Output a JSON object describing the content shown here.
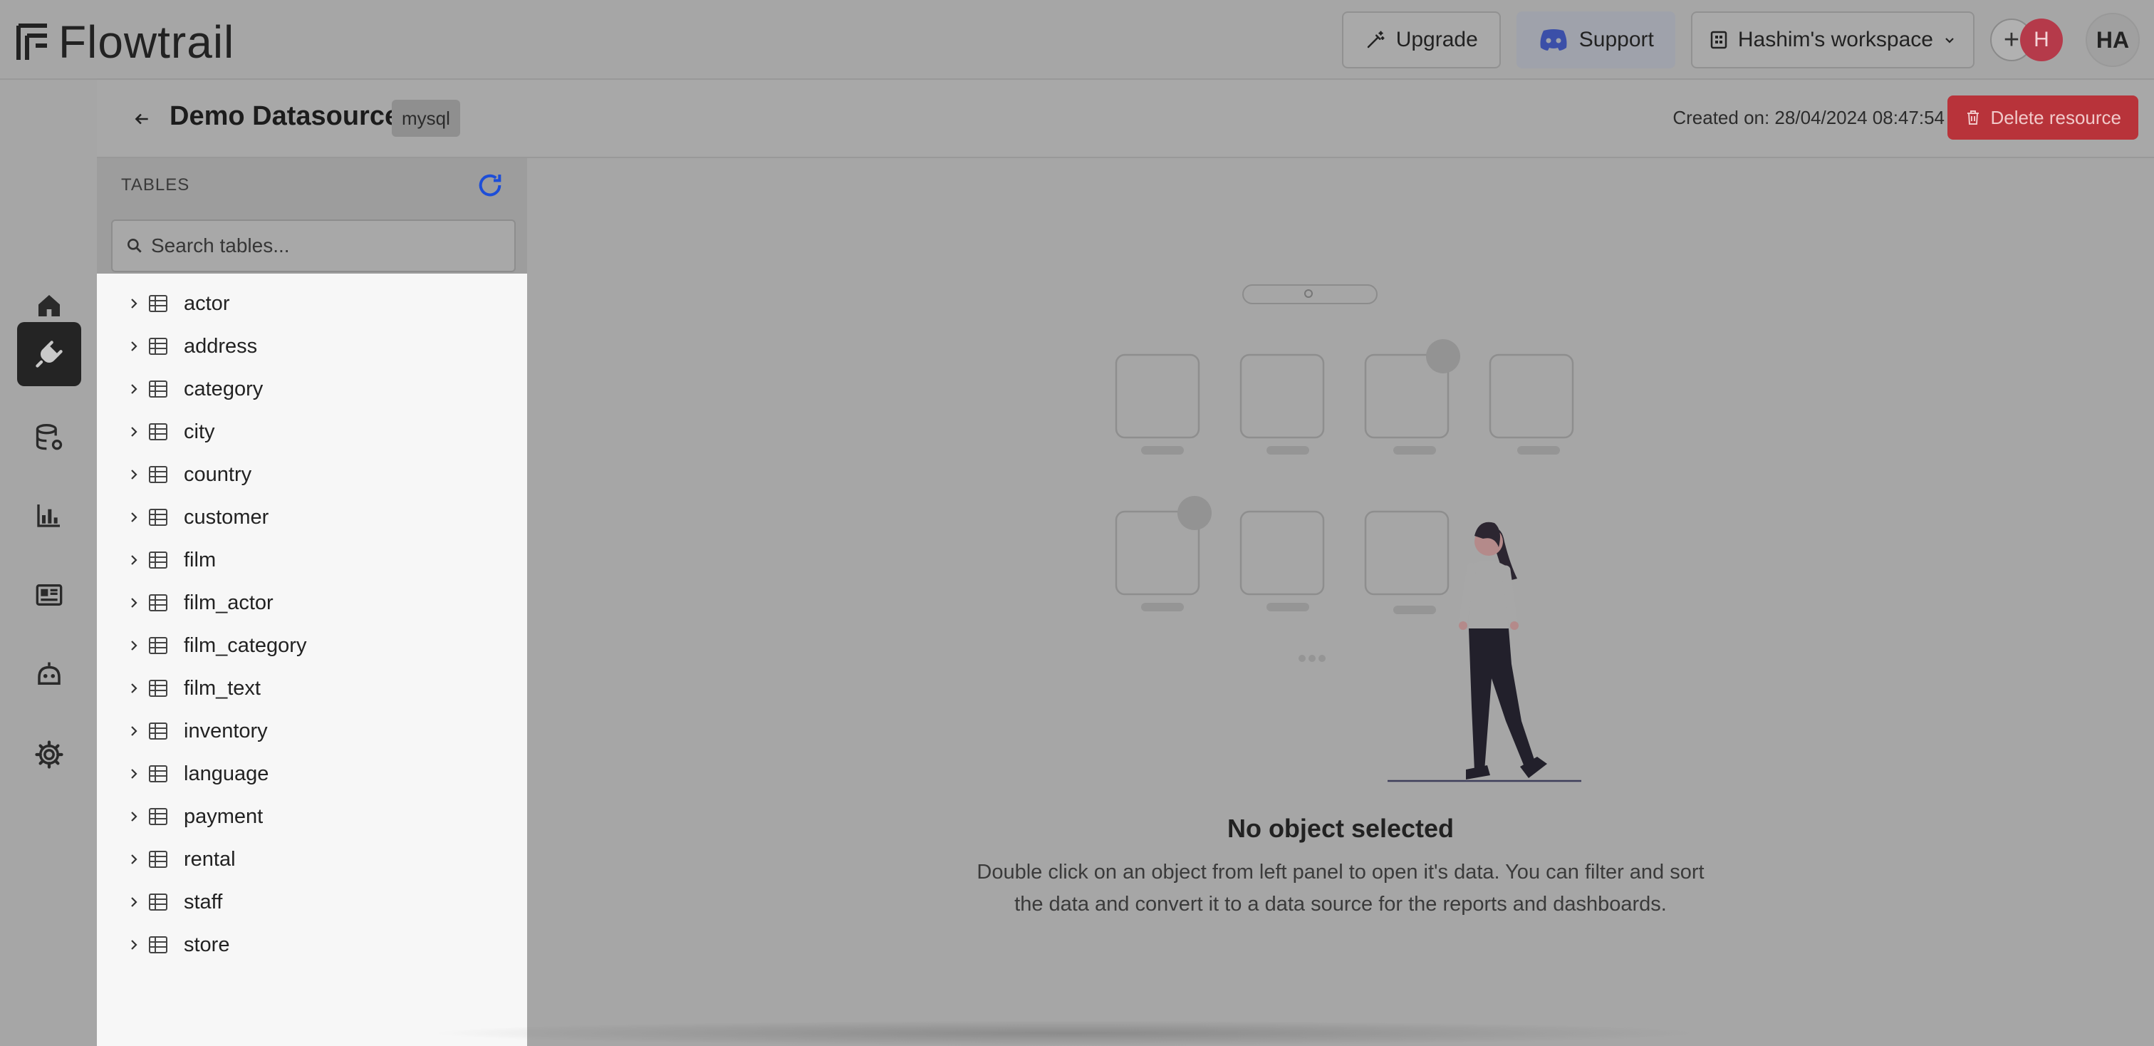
{
  "app": {
    "name": "Flowtrail"
  },
  "topbar": {
    "upgrade_label": "Upgrade",
    "support_label": "Support",
    "workspace_label": "Hashim's workspace",
    "member_initial": "H",
    "user_initials": "HA"
  },
  "nav": {
    "items": [
      {
        "icon": "home-icon",
        "active": false
      },
      {
        "icon": "plug-icon",
        "active": true
      },
      {
        "icon": "database-settings-icon",
        "active": false
      },
      {
        "icon": "bar-chart-icon",
        "active": false
      },
      {
        "icon": "dashboard-icon",
        "active": false
      },
      {
        "icon": "bot-icon",
        "active": false
      },
      {
        "icon": "gear-icon",
        "active": false
      }
    ]
  },
  "header": {
    "title": "Demo Datasource",
    "type_tag": "mysql",
    "created": "Created on: 28/04/2024 08:47:54",
    "delete_label": "Delete resource"
  },
  "tables_panel": {
    "heading": "TABLES",
    "search_placeholder": "Search tables...",
    "tables": [
      "actor",
      "address",
      "category",
      "city",
      "country",
      "customer",
      "film",
      "film_actor",
      "film_category",
      "film_text",
      "inventory",
      "language",
      "payment",
      "rental",
      "staff",
      "store"
    ]
  },
  "empty_state": {
    "title": "No object selected",
    "line1": "Double click on an object from left panel to open it's data. You can filter and sort",
    "line2": "the data and convert it to a data source for the reports and dashboards."
  },
  "colors": {
    "accent_blue": "#1d4ed8",
    "danger": "#b8333a",
    "active_nav": "#242424"
  }
}
